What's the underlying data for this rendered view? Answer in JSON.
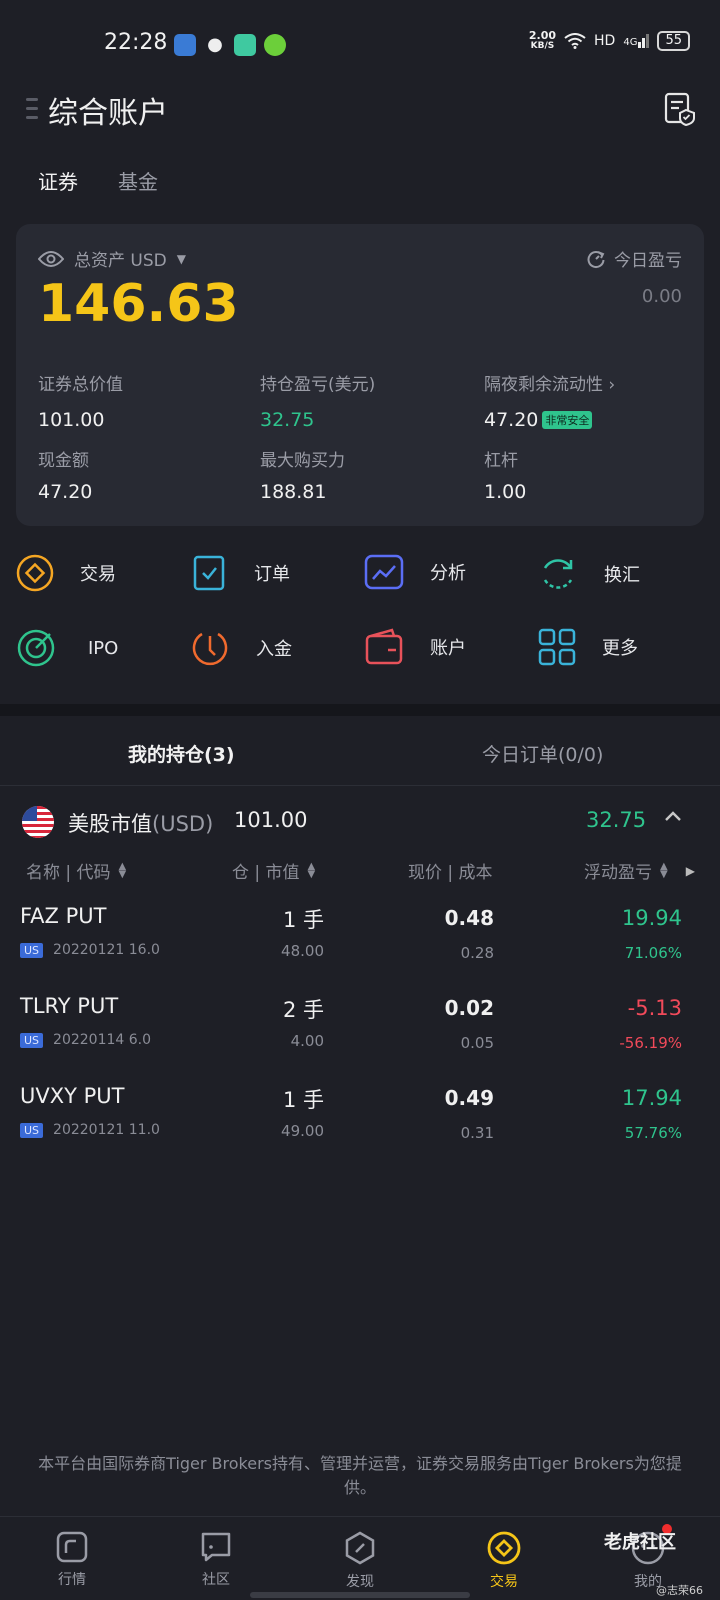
{
  "status_bar": {
    "time": "22:28",
    "net_speed_top": "2.00",
    "net_speed_bottom": "KB/S",
    "hd": "HD",
    "signal": "4G",
    "battery": "55"
  },
  "header": {
    "title": "综合账户"
  },
  "tabs": [
    {
      "label": "证券"
    },
    {
      "label": "基金"
    }
  ],
  "summary": {
    "asset_label": "总资产 USD",
    "total": "146.63",
    "today_label": "今日盈亏",
    "today_value": "0.00",
    "stats": [
      {
        "label": "证券总价值",
        "value": "101.00"
      },
      {
        "label": "持仓盈亏(美元)",
        "value": "32.75"
      },
      {
        "label": "隔夜剩余流动性",
        "value": "47.20",
        "badge": "非常安全"
      },
      {
        "label": "现金额",
        "value": "47.20"
      },
      {
        "label": "最大购买力",
        "value": "188.81"
      },
      {
        "label": "杠杆",
        "value": "1.00"
      }
    ]
  },
  "actions": [
    {
      "label": "交易",
      "icon": "trade-icon",
      "color": "#f5a623"
    },
    {
      "label": "订单",
      "icon": "order-icon",
      "color": "#3ab3d9"
    },
    {
      "label": "分析",
      "icon": "analysis-icon",
      "color": "#5b6ef5"
    },
    {
      "label": "换汇",
      "icon": "exchange-icon",
      "color": "#2fc4a6"
    },
    {
      "label": "IPO",
      "icon": "ipo-icon",
      "color": "#2fc48d"
    },
    {
      "label": "入金",
      "icon": "deposit-icon",
      "color": "#f06a2e"
    },
    {
      "label": "账户",
      "icon": "wallet-icon",
      "color": "#e8525a"
    },
    {
      "label": "更多",
      "icon": "grid-icon",
      "color": "#3ab3d9"
    }
  ],
  "positions_tabs": {
    "holdings": "我的持仓(3)",
    "orders": "今日订单(0/0)"
  },
  "market": {
    "title": "美股市值",
    "currency": "(USD)",
    "value": "101.00",
    "pl": "32.75"
  },
  "columns": {
    "name": "名称 | 代码",
    "position": "仓 | 市值",
    "price": "现价 | 成本",
    "pl": "浮动盈亏"
  },
  "holdings": [
    {
      "name": "FAZ PUT",
      "market": "US",
      "contract": "20220121 16.0",
      "qty": "1 手",
      "market_value": "48.00",
      "price": "0.48",
      "cost": "0.28",
      "pl": "19.94",
      "pl_pct": "71.06%",
      "direction": "up"
    },
    {
      "name": "TLRY PUT",
      "market": "US",
      "contract": "20220114 6.0",
      "qty": "2 手",
      "market_value": "4.00",
      "price": "0.02",
      "cost": "0.05",
      "pl": "-5.13",
      "pl_pct": "-56.19%",
      "direction": "down"
    },
    {
      "name": "UVXY PUT",
      "market": "US",
      "contract": "20220121 11.0",
      "qty": "1 手",
      "market_value": "49.00",
      "price": "0.49",
      "cost": "0.31",
      "pl": "17.94",
      "pl_pct": "57.76%",
      "direction": "up"
    }
  ],
  "disclaimer": "本平台由国际券商Tiger Brokers持有、管理并运营，证券交易服务由Tiger Brokers为您提供。",
  "bottom_nav": [
    {
      "label": "行情"
    },
    {
      "label": "社区"
    },
    {
      "label": "发现"
    },
    {
      "label": "交易"
    },
    {
      "label": "我的"
    }
  ],
  "watermark": {
    "text": "老虎社区",
    "sub": "@志荣66"
  }
}
